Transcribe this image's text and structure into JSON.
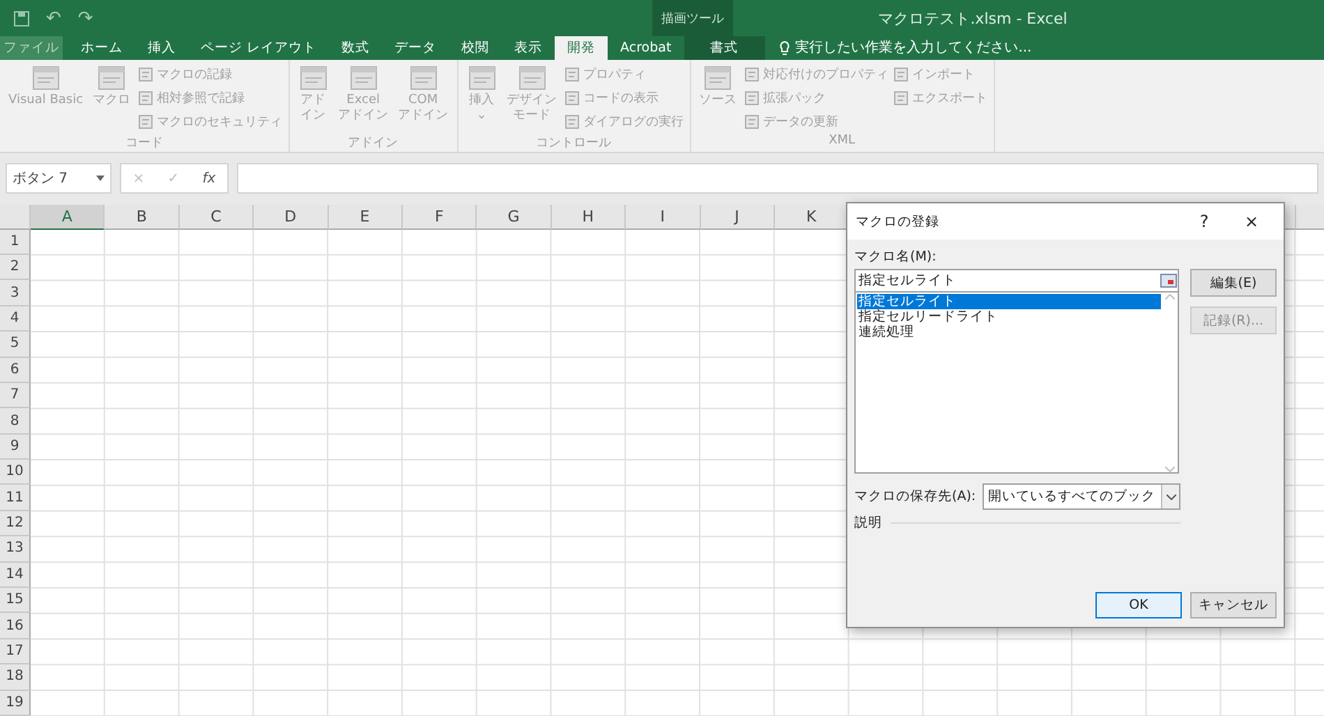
{
  "window": {
    "title": "マクロテスト.xlsm - Excel",
    "quick_access": [
      "↶",
      "↷"
    ],
    "context_group": "描画ツール"
  },
  "tabs": [
    {
      "label": "ファイル",
      "kind": "file",
      "selected": false
    },
    {
      "label": "ホーム",
      "kind": "normal",
      "selected": false
    },
    {
      "label": "挿入",
      "kind": "normal",
      "selected": false
    },
    {
      "label": "ページ レイアウト",
      "kind": "normal",
      "selected": false
    },
    {
      "label": "数式",
      "kind": "normal",
      "selected": false
    },
    {
      "label": "データ",
      "kind": "normal",
      "selected": false
    },
    {
      "label": "校閲",
      "kind": "normal",
      "selected": false
    },
    {
      "label": "表示",
      "kind": "normal",
      "selected": false
    },
    {
      "label": "開発",
      "kind": "normal",
      "selected": true
    },
    {
      "label": "Acrobat",
      "kind": "normal",
      "selected": false
    },
    {
      "label": "書式",
      "kind": "context",
      "selected": false
    }
  ],
  "tell_me": {
    "placeholder": "実行したい作業を入力してください..."
  },
  "ribbon": [
    {
      "name": "コード",
      "large": [
        {
          "lines": [
            "Visual Basic"
          ]
        },
        {
          "lines": [
            "マクロ"
          ]
        }
      ],
      "small": [
        [
          "マクロの記録",
          "相対参照で記録",
          "マクロのセキュリティ"
        ]
      ]
    },
    {
      "name": "アドイン",
      "large": [
        {
          "lines": [
            "アド",
            "イン"
          ]
        },
        {
          "lines": [
            "Excel",
            "アドイン"
          ]
        },
        {
          "lines": [
            "COM",
            "アドイン"
          ]
        }
      ]
    },
    {
      "name": "コントロール",
      "large": [
        {
          "lines": [
            "挿入",
            "⌄"
          ]
        },
        {
          "lines": [
            "デザイン",
            "モード"
          ]
        }
      ],
      "small": [
        [
          "プロパティ",
          "コードの表示",
          "ダイアログの実行"
        ]
      ]
    },
    {
      "name": "XML",
      "large": [
        {
          "lines": [
            "ソース"
          ]
        }
      ],
      "small": [
        [
          "対応付けのプロパティ",
          "拡張パック",
          "データの更新"
        ],
        [
          "インポート",
          "エクスポート"
        ]
      ]
    }
  ],
  "formula_bar": {
    "name_box": "ボタン 7",
    "buttons": [
      "×",
      "✓",
      "fx"
    ]
  },
  "sheet": {
    "columns": [
      {
        "label": "A",
        "selected": true
      },
      {
        "label": "B",
        "selected": false
      },
      {
        "label": "C",
        "selected": false
      },
      {
        "label": "D",
        "selected": false
      },
      {
        "label": "E",
        "selected": false
      },
      {
        "label": "F",
        "selected": false
      },
      {
        "label": "G",
        "selected": false
      },
      {
        "label": "H",
        "selected": false
      },
      {
        "label": "I",
        "selected": false
      },
      {
        "label": "J",
        "selected": false
      },
      {
        "label": "K",
        "selected": false
      }
    ],
    "rows": [
      "1",
      "2",
      "3",
      "4",
      "5",
      "6",
      "7",
      "8",
      "9",
      "10",
      "11",
      "12",
      "13",
      "14",
      "15",
      "16",
      "17",
      "18",
      "19"
    ]
  },
  "dialog": {
    "title": "マクロの登録",
    "help": "?",
    "close": "×",
    "name_label": "マクロ名(M):",
    "name_value": "指定セルライト",
    "macros": [
      {
        "label": "指定セルライト",
        "selected": true
      },
      {
        "label": "指定セルリードライト",
        "selected": false
      },
      {
        "label": "連続処理",
        "selected": false
      }
    ],
    "side_buttons": [
      {
        "label": "編集(E)",
        "disabled": false
      },
      {
        "label": "記録(R)...",
        "disabled": true
      }
    ],
    "store_label": "マクロの保存先(A):",
    "store_value": "開いているすべてのブック",
    "description_label": "説明",
    "buttons": [
      {
        "label": "OK",
        "kind": "default"
      },
      {
        "label": "キャンセル",
        "kind": "normal"
      }
    ]
  }
}
